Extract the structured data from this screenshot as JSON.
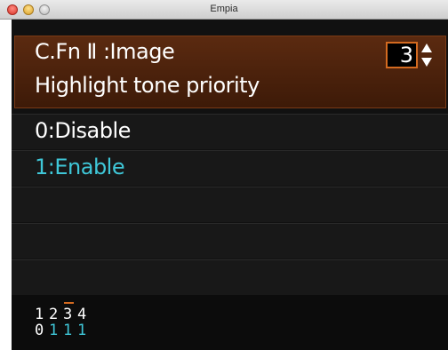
{
  "window": {
    "title": "Empia"
  },
  "menu": {
    "function_group": "C.Fn Ⅱ :Image",
    "function_name": "Highlight tone priority",
    "page_number": "3",
    "options": [
      {
        "label": "0:Disable",
        "selected": false
      },
      {
        "label": "1:Enable",
        "selected": true
      }
    ],
    "empty_rows": 3
  },
  "summary": {
    "function_numbers": [
      "1",
      "2",
      "3",
      "4"
    ],
    "function_values": [
      "0",
      "1",
      "1",
      "1"
    ],
    "current_index": 2
  },
  "colors": {
    "accent": "#d36a20",
    "selected_text": "#3fc7d8",
    "header_bg": "#4a200c"
  }
}
